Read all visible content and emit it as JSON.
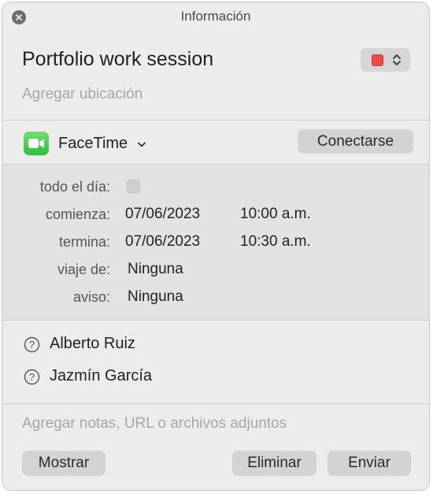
{
  "window": {
    "title": "Información"
  },
  "event": {
    "title": "Portfolio work session",
    "location_placeholder": "Agregar ubicación",
    "calendar_color": "#ee4b45"
  },
  "video_call": {
    "app": "FaceTime",
    "connect_label": "Conectarse"
  },
  "details": {
    "all_day_label": "todo el día:",
    "all_day_checked": false,
    "starts_label": "comienza:",
    "starts_date": "07/06/2023",
    "starts_time": "10:00 a.m.",
    "ends_label": "termina:",
    "ends_date": "07/06/2023",
    "ends_time": "10:30 a.m.",
    "travel_label": "viaje de:",
    "travel_value": "Ninguna",
    "alert_label": "aviso:",
    "alert_value": "Ninguna"
  },
  "attendees": [
    {
      "name": "Alberto Ruiz",
      "icon": "question-circle-icon"
    },
    {
      "name": "Jazmín García",
      "icon": "question-circle-icon"
    }
  ],
  "notes_placeholder": "Agregar notas, URL o archivos adjuntos",
  "buttons": {
    "show": "Mostrar",
    "delete": "Eliminar",
    "send": "Enviar"
  }
}
